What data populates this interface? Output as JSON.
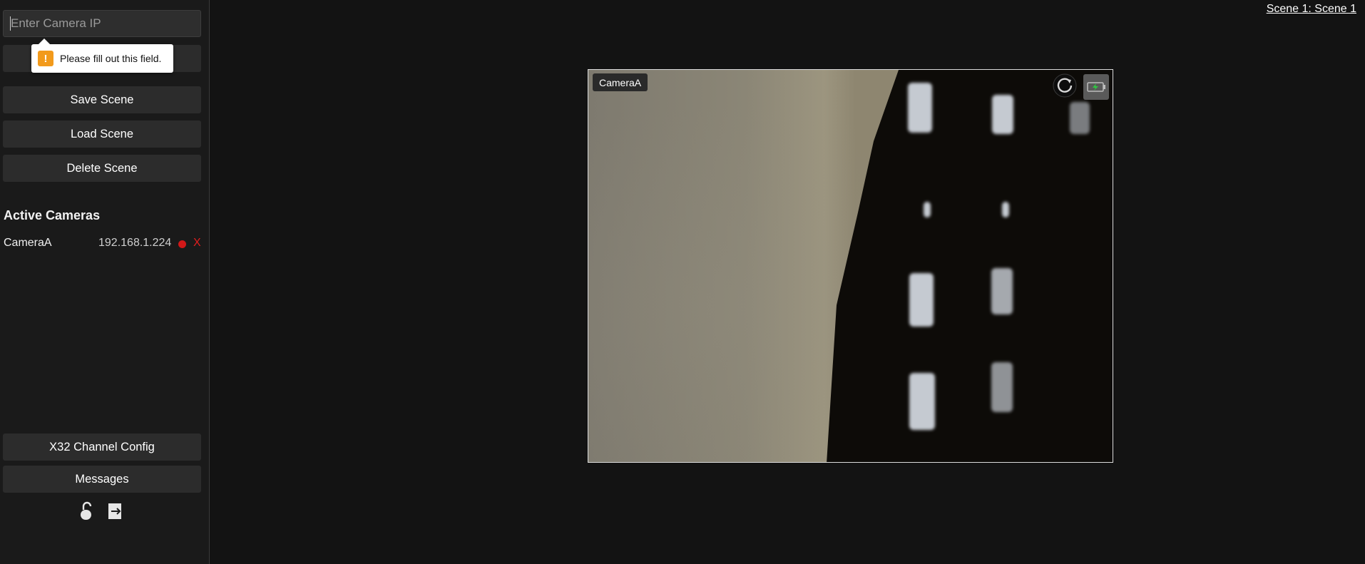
{
  "sidebar": {
    "ip_input": {
      "value": "",
      "placeholder": "Enter Camera IP"
    },
    "hidden_button_label": "",
    "validation_tooltip": "Please fill out this field.",
    "buttons": {
      "save_scene": "Save Scene",
      "load_scene": "Load Scene",
      "delete_scene": "Delete Scene",
      "x32_config": "X32 Channel Config",
      "messages": "Messages"
    },
    "active_cameras_title": "Active Cameras",
    "cameras": [
      {
        "name": "CameraA",
        "ip": "192.168.1.224",
        "status_color": "#d11818",
        "remove_label": "X"
      }
    ],
    "footer_icons": [
      "lock-icon",
      "exit-icon"
    ]
  },
  "scene": {
    "label": "Scene 1: Scene 1"
  },
  "feed": {
    "camera_label": "CameraA",
    "icons": [
      "refresh-icon",
      "battery-icon"
    ]
  },
  "colors": {
    "background": "#131313",
    "sidebar": "#1a1a1a",
    "button": "#2c2c2c",
    "warning": "#f29a1b",
    "live_dot": "#d11818",
    "battery_charge": "#2ecc40"
  }
}
